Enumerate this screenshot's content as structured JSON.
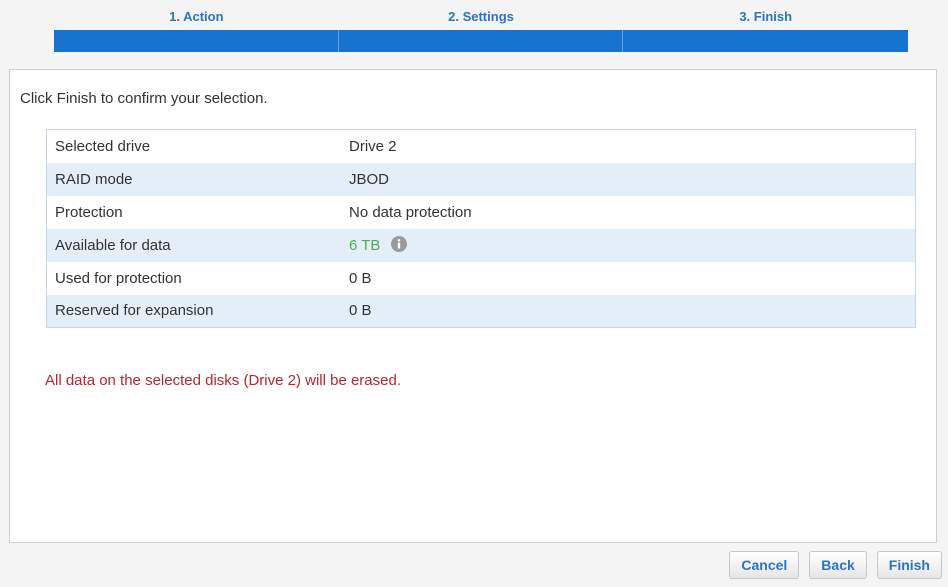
{
  "wizard": {
    "steps": [
      {
        "label": "1. Action"
      },
      {
        "label": "2. Settings"
      },
      {
        "label": "3. Finish"
      }
    ]
  },
  "main": {
    "intro": "Click Finish to confirm your selection.",
    "rows": [
      {
        "label": "Selected drive",
        "value": "Drive 2"
      },
      {
        "label": "RAID mode",
        "value": "JBOD"
      },
      {
        "label": "Protection",
        "value": "No data protection"
      },
      {
        "label": "Available for data",
        "value": "6 TB",
        "icon": "info-icon"
      },
      {
        "label": "Used for protection",
        "value": "0 B"
      },
      {
        "label": "Reserved for expansion",
        "value": "0 B"
      }
    ],
    "warning": "All data on the selected disks (Drive 2) will be erased."
  },
  "footer": {
    "cancel_label": "Cancel",
    "back_label": "Back",
    "finish_label": "Finish"
  },
  "colors": {
    "accent": "#1674cf",
    "value_highlight": "#4caf50",
    "warning": "#b3282d"
  }
}
